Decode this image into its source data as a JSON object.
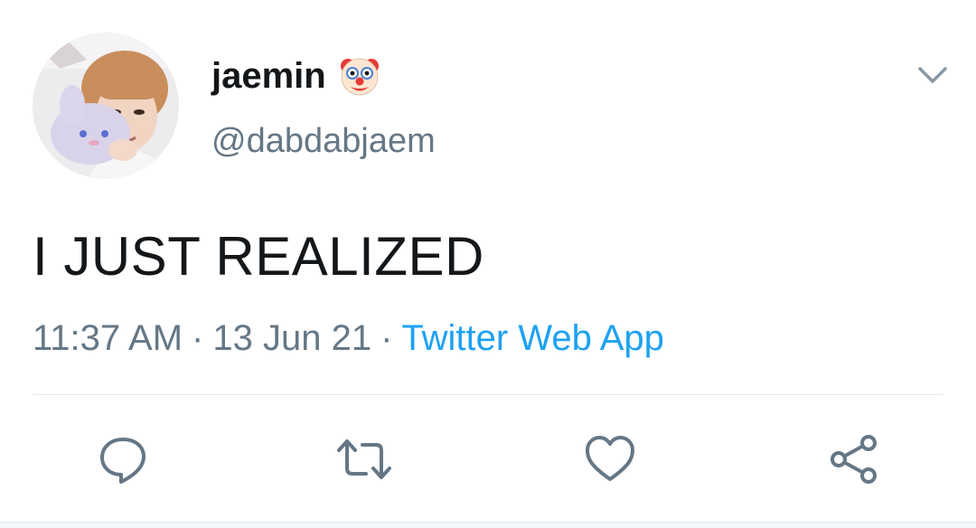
{
  "tweet": {
    "display_name": "jaemin",
    "name_emoji": "clown-face-emoji",
    "handle": "@dabdabjaem",
    "text": "I JUST REALIZED",
    "time": "11:37 AM",
    "separator": "·",
    "date": "13 Jun 21",
    "source": "Twitter Web App"
  },
  "icons": {
    "menu": "chevron-down-icon",
    "reply": "reply-icon",
    "retweet": "retweet-icon",
    "like": "heart-icon",
    "share": "share-icon"
  },
  "colors": {
    "text": "#14171a",
    "secondary": "#657786",
    "link": "#1da1f2",
    "divider": "#e1e8ed"
  }
}
